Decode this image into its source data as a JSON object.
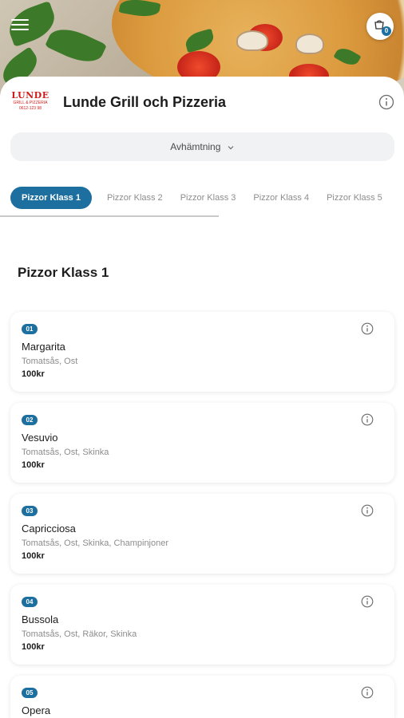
{
  "header": {
    "logo_line1": "LUNDE",
    "logo_line2": "GRILL & PIZZERIA",
    "logo_line3": "0612-123 98",
    "store_name": "Lunde Grill och Pizzeria",
    "cart_count": "0"
  },
  "mode_selector": {
    "label": "Avhämtning"
  },
  "tabs": [
    {
      "label": "Pizzor Klass 1",
      "active": true
    },
    {
      "label": "Pizzor Klass 2"
    },
    {
      "label": "Pizzor Klass 3"
    },
    {
      "label": "Pizzor Klass 4"
    },
    {
      "label": "Pizzor Klass 5"
    }
  ],
  "section": {
    "title": "Pizzor Klass 1"
  },
  "items": [
    {
      "number": "01",
      "name": "Margarita",
      "description": "Tomatsås, Ost",
      "price": "100kr"
    },
    {
      "number": "02",
      "name": "Vesuvio",
      "description": "Tomatsås, Ost, Skinka",
      "price": "100kr"
    },
    {
      "number": "03",
      "name": "Capricciosa",
      "description": "Tomatsås, Ost, Skinka, Champinjoner",
      "price": "100kr"
    },
    {
      "number": "04",
      "name": "Bussola",
      "description": "Tomatsås, Ost, Räkor, Skinka",
      "price": "100kr"
    },
    {
      "number": "05",
      "name": "Opera",
      "description": "",
      "price": ""
    }
  ],
  "colors": {
    "accent": "#1d6fa0",
    "logo_red": "#d11b1b"
  },
  "icons": {
    "menu": "hamburger-icon",
    "cart": "cart-icon",
    "info": "info-icon",
    "chevron": "chevron-down-icon"
  }
}
